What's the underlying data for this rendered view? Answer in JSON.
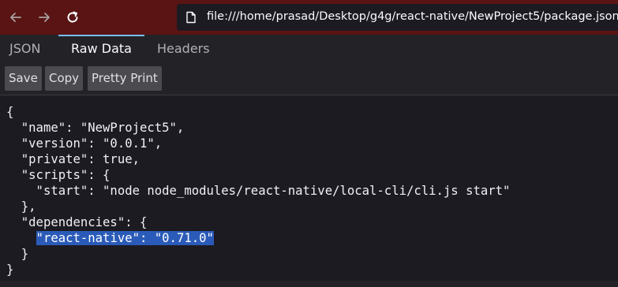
{
  "browser": {
    "url": "file:///home/prasad/Desktop/g4g/react-native/NewProject5/package.json",
    "accent_color": "#5a1414",
    "icons": [
      "back-arrow-icon",
      "forward-arrow-icon",
      "reload-icon",
      "file-icon"
    ]
  },
  "tabs": [
    {
      "label": "JSON"
    },
    {
      "label": "Raw Data"
    },
    {
      "label": "Headers"
    }
  ],
  "toolbar": {
    "save_label": "Save",
    "copy_label": "Copy",
    "pretty_label": "Pretty Print"
  },
  "raw_json": {
    "lines": [
      "{",
      "  \"name\": \"NewProject5\",",
      "  \"version\": \"0.0.1\",",
      "  \"private\": true,",
      "  \"scripts\": {",
      "    \"start\": \"node node_modules/react-native/local-cli/cli.js start\"",
      "  },",
      "  \"dependencies\": {",
      "\"react-native\": \"0.71.0\"",
      "  }",
      "}"
    ],
    "selected_line_indent": "    "
  }
}
